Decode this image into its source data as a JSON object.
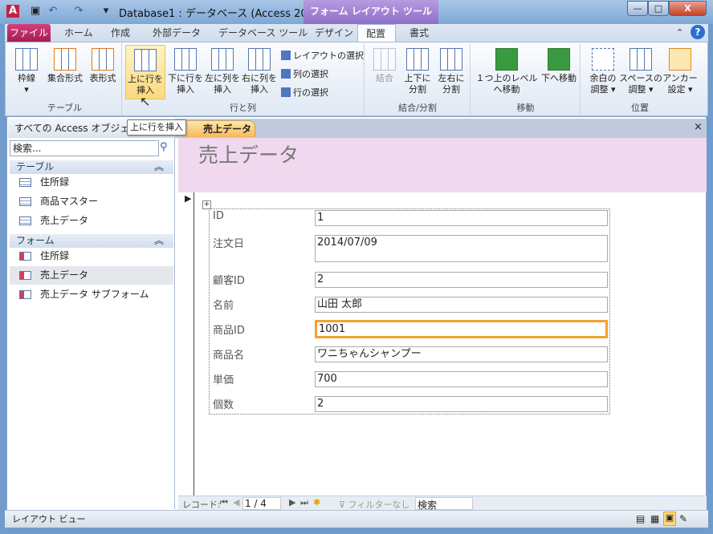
{
  "window": {
    "title": "Database1 : データベース (Access 200...",
    "context_tab": "フォーム レイアウト ツール"
  },
  "ribbon_tabs": [
    "ファイル",
    "ホーム",
    "作成",
    "外部データ",
    "データベース ツール",
    "デザイン",
    "配置",
    "書式"
  ],
  "active_tab": "配置",
  "groups": [
    {
      "label": "テーブル",
      "buttons": [
        "枠線",
        "集合形式",
        "表形式"
      ]
    },
    {
      "label": "行と列",
      "buttons": [
        "上に行を\n挿入",
        "下に行を\n挿入",
        "左に列を\n挿入",
        "右に列を\n挿入"
      ],
      "small": [
        "レイアウトの選択",
        "列の選択",
        "行の選択"
      ]
    },
    {
      "label": "結合/分割",
      "buttons": [
        "結合",
        "上下に\n分割",
        "左右に\n分割"
      ]
    },
    {
      "label": "移動",
      "buttons": [
        "１つ上のレベル\nへ移動",
        "下へ移動"
      ]
    },
    {
      "label": "位置",
      "buttons": [
        "余白の\n調整 ▾",
        "スペースの\n調整 ▾",
        "アンカー\n設定 ▾"
      ]
    }
  ],
  "tooltip": "上に行を挿入",
  "nav": {
    "header": "すべての Access オブジェクト",
    "search_placeholder": "検索...",
    "groups": [
      {
        "label": "テーブル",
        "items": [
          "住所録",
          "商品マスター",
          "売上データ"
        ]
      },
      {
        "label": "フォーム",
        "items": [
          "住所録",
          "売上データ",
          "売上データ サブフォーム"
        ]
      }
    ],
    "selected": "売上データ"
  },
  "doc_tab": "売上データ",
  "form": {
    "title": "売上データ",
    "fields": [
      {
        "label": "ID",
        "value": "1"
      },
      {
        "label": "注文日",
        "value": "2014/07/09"
      },
      {
        "label": "顧客ID",
        "value": "2"
      },
      {
        "label": "名前",
        "value": "山田 太郎"
      },
      {
        "label": "商品ID",
        "value": "1001"
      },
      {
        "label": "商品名",
        "value": "ワニちゃんシャンプー"
      },
      {
        "label": "単価",
        "value": "700"
      },
      {
        "label": "個数",
        "value": "2"
      }
    ]
  },
  "record_nav": {
    "label": "レコード:",
    "current": "1 / 4",
    "filter": "フィルターなし",
    "search": "検索"
  },
  "status": {
    "text": "レイアウト ビュー"
  },
  "colors": {
    "accent": "#f5a030",
    "file_tab": "#b8235d",
    "context": "#8e6fc9"
  }
}
